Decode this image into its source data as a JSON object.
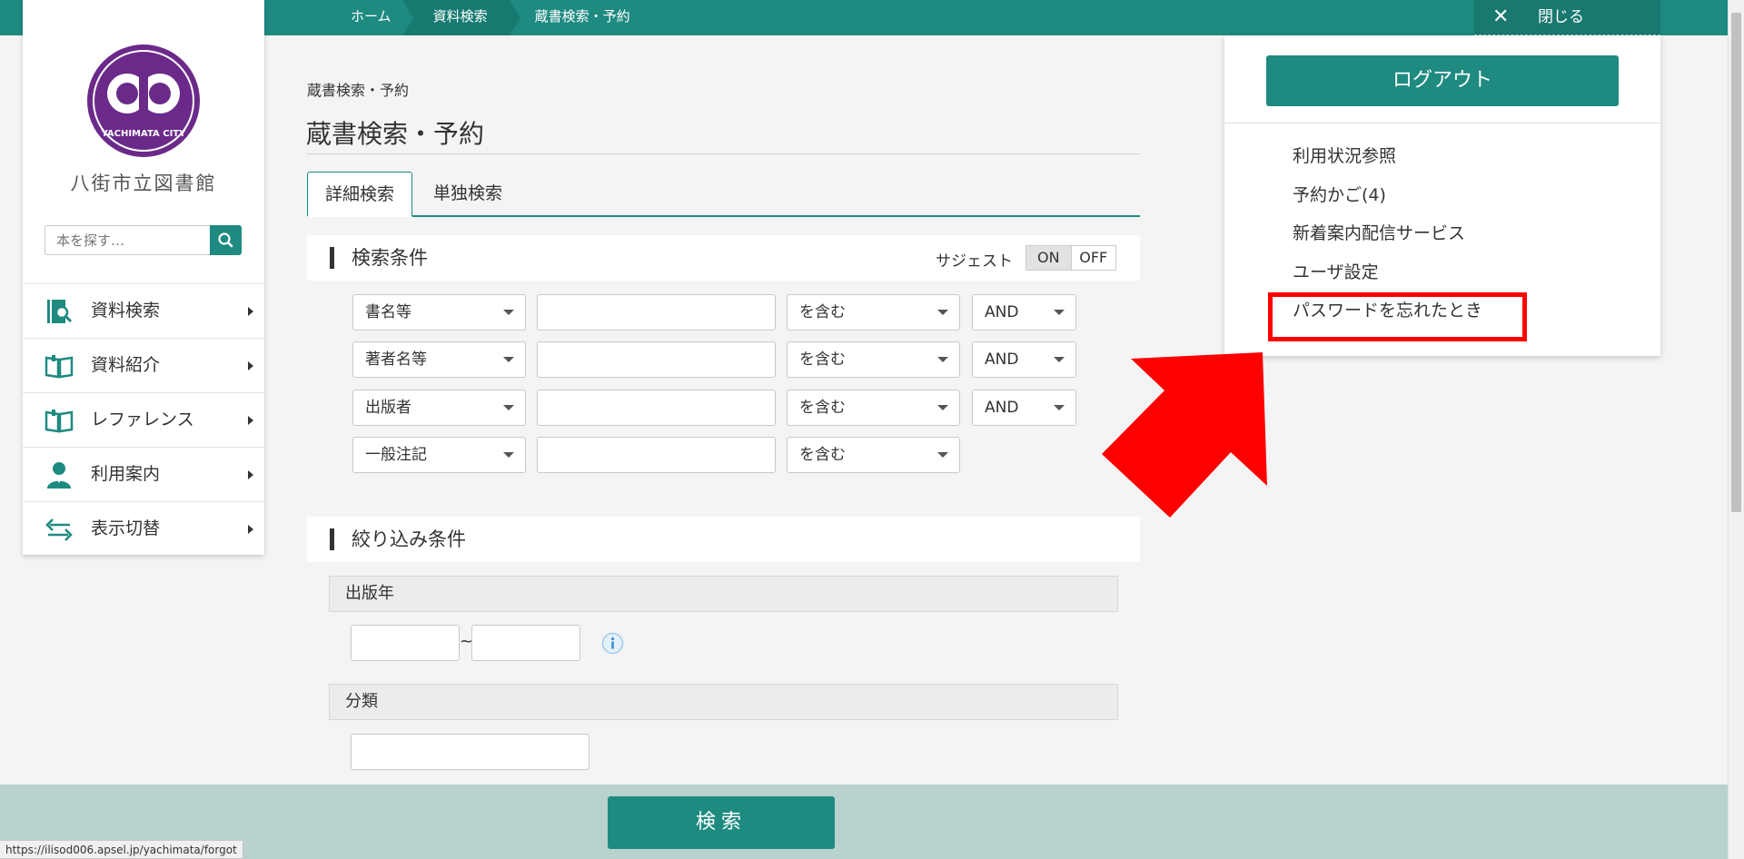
{
  "topbar": {
    "breadcrumbs": [
      "ホーム",
      "資料検索",
      "蔵書検索・予約"
    ],
    "close_label": "閉じる"
  },
  "sidebar": {
    "logo_text": "YACHIMATA CITY",
    "library_name": "八街市立図書館",
    "search_placeholder": "本を探す…",
    "items": [
      {
        "label": "資料検索",
        "icon": "book-search-icon"
      },
      {
        "label": "資料紹介",
        "icon": "open-book-icon"
      },
      {
        "label": "レファレンス",
        "icon": "open-book-icon"
      },
      {
        "label": "利用案内",
        "icon": "person-icon"
      },
      {
        "label": "表示切替",
        "icon": "swap-arrows-icon"
      }
    ]
  },
  "main": {
    "breadcrumb": "蔵書検索・予約",
    "title": "蔵書検索・予約",
    "tabs": [
      "詳細検索",
      "単独検索"
    ],
    "search_section": {
      "title": "検索条件",
      "suggest_label": "サジェスト",
      "toggle_on": "ON",
      "toggle_off": "OFF",
      "rows": [
        {
          "field": "書名等",
          "match": "を含む",
          "op": "AND"
        },
        {
          "field": "著者名等",
          "match": "を含む",
          "op": "AND"
        },
        {
          "field": "出版者",
          "match": "を含む",
          "op": "AND"
        },
        {
          "field": "一般注記",
          "match": "を含む"
        }
      ]
    },
    "filter_section": {
      "title": "絞り込み条件",
      "pub_year_label": "出版年",
      "range_sep": "~",
      "class_label": "分類"
    },
    "submit_label": "検索"
  },
  "status_url": "https://ilisod006.apsel.jp/yachimata/forgot",
  "user_panel": {
    "logout_label": "ログアウト",
    "links": [
      "利用状況参照",
      "予約かご(4)",
      "新着案内配信サービス",
      "ユーザ設定",
      "パスワードを忘れたとき"
    ]
  },
  "colors": {
    "brand": "#1e8a80",
    "highlight": "#ff0000",
    "logo": "#6b2a8a"
  }
}
